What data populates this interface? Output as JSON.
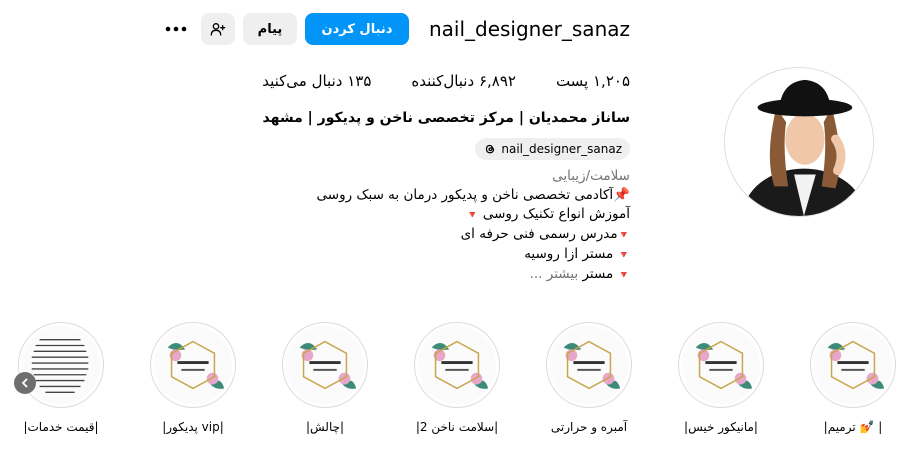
{
  "profile": {
    "username": "nail_designer_sanaz",
    "follow_label": "دنبال کردن",
    "message_label": "پیام",
    "suggest_icon": "person-add-icon",
    "more_icon": "more-horizontal-icon",
    "stats": {
      "posts": "۱,۲۰۵ پست",
      "followers": "۶,۸۹۲ دنبال‌کننده",
      "following": "۱۳۵ دنبال می‌کنید"
    },
    "full_name": "ساناز محمدیان | مرکز تخصصی ناخن و پدیکور | مشهد",
    "threads_handle": "nail_designer_sanaz",
    "bio": {
      "category": "سلامت/زیبایی",
      "line1": "📌آکادمی تخصصی ناخن و پدیکور درمان به سبک روسی",
      "line2": "آموزش انواع تکنیک روسی",
      "line3": "مدرس رسمی فنی حرفه ای",
      "line4": "مستر ازا روسیه",
      "line5_prefix": "مستر",
      "more": "بیشتر ..."
    }
  },
  "highlights": [
    {
      "label": "|ترمیم 💅 |",
      "icon": "highlight-cover-icon"
    },
    {
      "label": "|مانیکور خیس|",
      "icon": "highlight-cover-icon"
    },
    {
      "label": "آمبره و حرارتی",
      "icon": "highlight-cover-icon"
    },
    {
      "label": "|سلامت ناخن 2|",
      "icon": "highlight-cover-icon"
    },
    {
      "label": "|چالش|",
      "icon": "highlight-cover-icon"
    },
    {
      "label": "|پدیکور vip|",
      "icon": "highlight-cover-icon"
    },
    {
      "label": "|قیمت خدمات|",
      "icon": "price-list-icon"
    }
  ],
  "colors": {
    "accent": "#0095f6",
    "secondary_button": "#efefef",
    "muted_text": "#737373",
    "bullet_red": "#e0342c"
  }
}
